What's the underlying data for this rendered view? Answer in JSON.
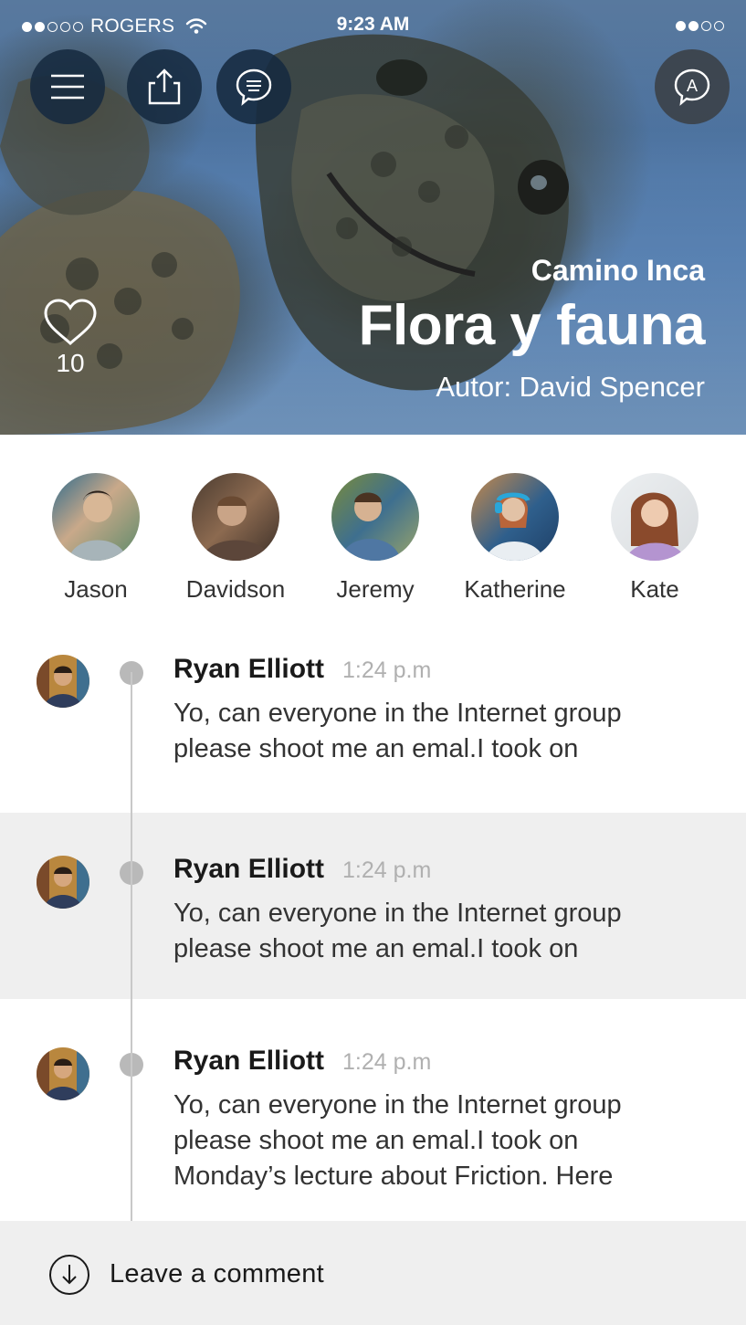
{
  "status_bar": {
    "carrier": "ROGERS",
    "time": "9:23 AM",
    "signal_dots_filled": 2,
    "signal_dots_total": 5,
    "battery_dots_filled": 2,
    "battery_dots_total": 4
  },
  "toolbar": {
    "menu_icon": "menu-icon",
    "share_icon": "share-icon",
    "chat_icon": "chat-icon",
    "profile_letter": "A"
  },
  "hero": {
    "subtitle": "Camino Inca",
    "title": "Flora y fauna",
    "author": "Autor: David Spencer",
    "likes": "10"
  },
  "participants": [
    {
      "name": "Jason",
      "color": "#3b6d8a"
    },
    {
      "name": "Davidson",
      "color": "#5a4a3c"
    },
    {
      "name": "Jeremy",
      "color": "#4f6c88"
    },
    {
      "name": "Katherine",
      "color": "#2f5f8c"
    },
    {
      "name": "Kate",
      "color": "#a26b4e"
    }
  ],
  "comments": [
    {
      "author": "Ryan Elliott",
      "time": "1:24 p.m",
      "lines": [
        "Yo, can everyone in the Internet group",
        "please shoot me an emal.I took on"
      ]
    },
    {
      "author": "Ryan Elliott",
      "time": "1:24 p.m",
      "lines": [
        "Yo, can everyone in the Internet group",
        "please shoot me an emal.I took on"
      ]
    },
    {
      "author": "Ryan Elliott",
      "time": "1:24 p.m",
      "lines": [
        "Yo, can everyone in the Internet group",
        "please shoot me an emal.I took on",
        "Monday’s lecture about Friction. Here"
      ]
    }
  ],
  "footer": {
    "label": "Leave a comment",
    "icon": "arrow-down-circle-icon"
  },
  "colors": {
    "accent_dark": "#162a40",
    "timeline": "#c8c8c8",
    "alt_row": "#efefef"
  }
}
